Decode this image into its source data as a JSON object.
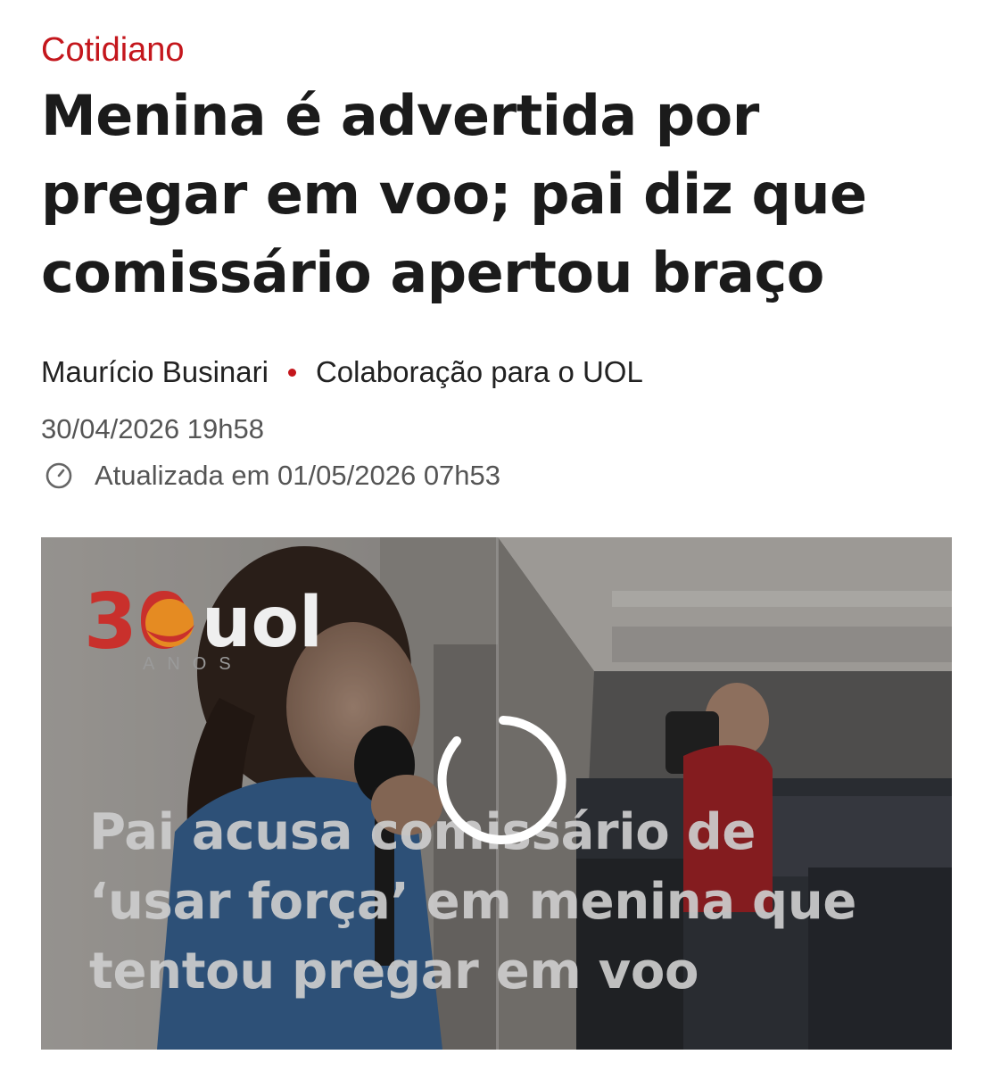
{
  "article": {
    "section": "Cotidiano",
    "headline_lines": [
      "Menina é advertida por",
      "pregar em voo; pai diz que",
      "comissário apertou braço"
    ],
    "author": "Maurício Businari",
    "source": "Colaboração para o UOL",
    "published": "30/04/2026 19h58",
    "updated": "Atualizada em 01/05/2026 07h53"
  },
  "video": {
    "logo_number": "30",
    "logo_brand": "uol",
    "logo_caption": "ANOS",
    "overlay_lines": [
      "Pai acusa comissário de",
      "‘usar força’ em menina que",
      "tentou pregar em voo"
    ],
    "state": "loading"
  },
  "colors": {
    "accent": "#c4161c",
    "headline": "#1b1b1b",
    "meta": "#555555"
  },
  "icons": {
    "clock": "clock-icon",
    "spinner": "loading-spinner-icon"
  }
}
